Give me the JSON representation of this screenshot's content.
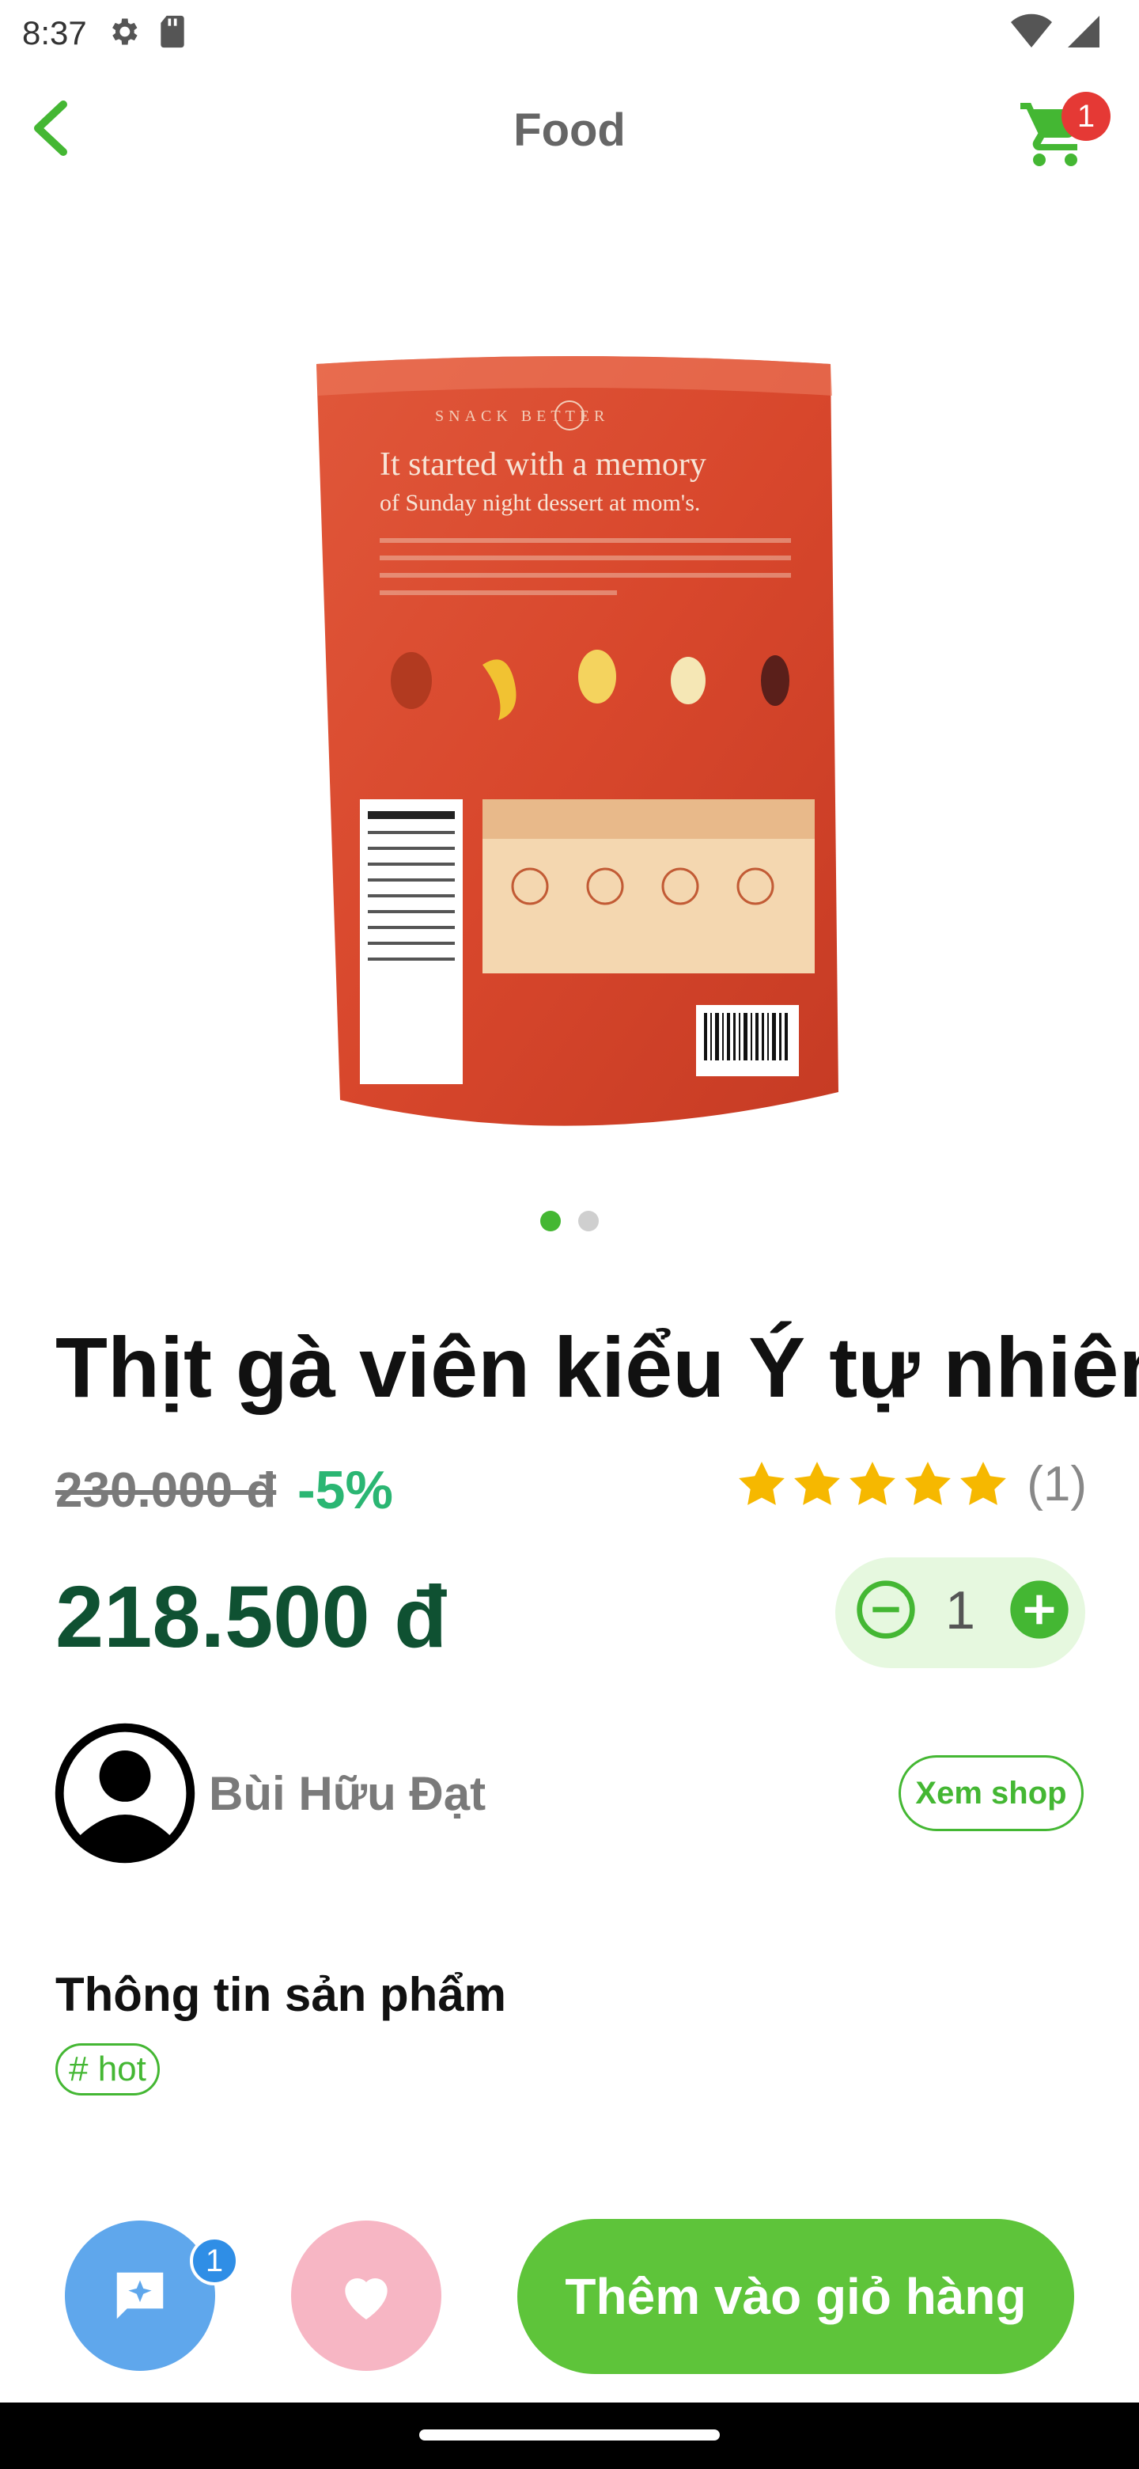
{
  "status_bar": {
    "time": "8:37",
    "icons": [
      "settings-icon",
      "sd-card-icon",
      "wifi-icon",
      "signal-icon"
    ]
  },
  "app_bar": {
    "title": "Food",
    "back_icon": "chevron-left-icon",
    "cart_icon": "cart-icon",
    "cart_badge": "1",
    "accent_color": "#44b733"
  },
  "gallery": {
    "image_count": 2,
    "active_index": 0
  },
  "product": {
    "title": "Thịt gà viên kiểu Ý tự nhiên",
    "old_price": "230.000 đ",
    "discount": "-5%",
    "rating_stars": 5,
    "rating_count": "(1)",
    "price": "218.500 đ",
    "quantity": "1"
  },
  "shop": {
    "name": "Bùi Hữu Đạt",
    "view_button": "Xem shop"
  },
  "info": {
    "heading": "Thông tin sản phẩm",
    "tag": "# hot"
  },
  "actions": {
    "chat_badge": "1",
    "add_to_cart": "Thêm vào giỏ hàng",
    "chat_color": "#5fa7ec",
    "favorite_color": "#f7b6c4",
    "add_cart_color": "#5ec43a"
  }
}
